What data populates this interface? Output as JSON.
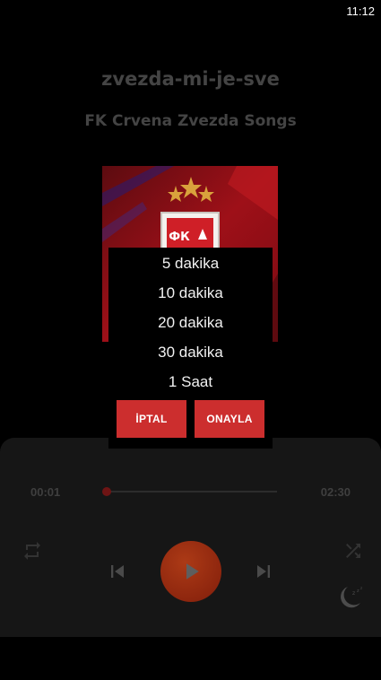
{
  "status_bar": {
    "time": "11:12"
  },
  "track": {
    "title": "zvezda-mi-je-sve",
    "artist": "FK Crvena Zvezda Songs"
  },
  "album_art": {
    "crest_letters": "ФК"
  },
  "player": {
    "current_time": "00:01",
    "total_time": "02:30",
    "progress_fraction": 0.007
  },
  "icons": {
    "repeat": "repeat-icon",
    "previous": "skip-previous-icon",
    "play": "play-icon",
    "next": "skip-next-icon",
    "shuffle": "shuffle-icon",
    "sleep_timer": "moon-sleep-icon"
  },
  "sleep_dialog": {
    "options": [
      "5 dakika",
      "10 dakika",
      "20 dakika",
      "30 dakika",
      "1 Saat"
    ],
    "cancel_label": "İPTAL",
    "confirm_label": "ONAYLA"
  },
  "colors": {
    "accent": "#cc2e2e",
    "play_button": "#9b2d11",
    "background": "#000000",
    "panel": "#161616"
  }
}
